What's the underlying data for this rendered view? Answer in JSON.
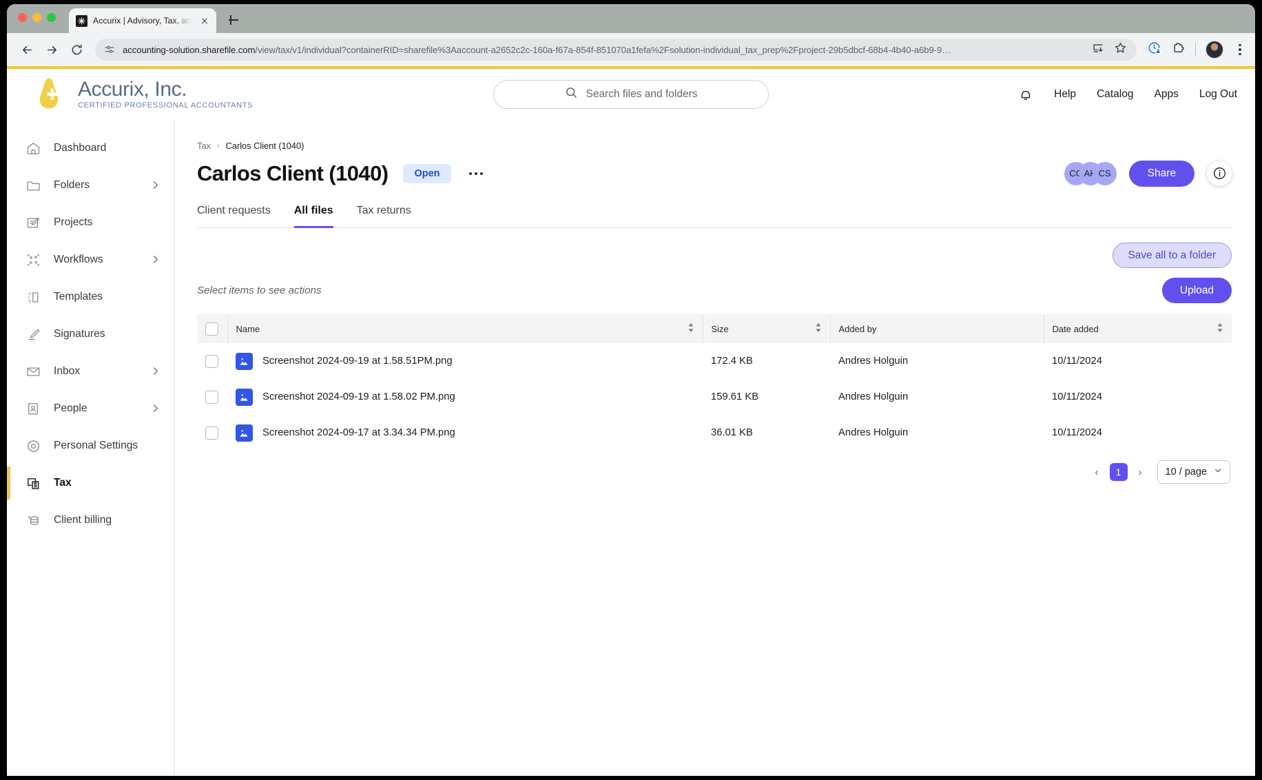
{
  "browser": {
    "tab_title": "Accurix | Advisory, Tax, and A",
    "url_domain": "accounting-solution.sharefile.com",
    "url_path": "/view/tax/v1/individual?containerRID=sharefile%3Aaccount-a2652c2c-160a-f67a-854f-851070a1fefa%2Fsolution-individual_tax_prep%2Fproject-29b5dbcf-68b4-4b40-a6b9-9…",
    "icons": {
      "back": "back-arrow-icon",
      "forward": "forward-arrow-icon",
      "reload": "reload-icon",
      "site_settings": "site-settings-icon",
      "install": "install-app-icon",
      "bookmark": "bookmark-star-icon",
      "extension_shield": "history-sync-icon",
      "extensions": "extensions-puzzle-icon",
      "profile": "profile-avatar-icon",
      "menu": "three-dot-menu-icon"
    }
  },
  "header": {
    "brand_name": "Accurix, Inc.",
    "brand_tagline": "CERTIFIED PROFESSIONAL ACCOUNTANTS",
    "search_placeholder": "Search files and folders",
    "nav": [
      {
        "label": "Help"
      },
      {
        "label": "Catalog"
      },
      {
        "label": "Apps"
      },
      {
        "label": "Log Out"
      }
    ],
    "notification_icon": "bell-icon",
    "accent_bar_color": "#efc94c"
  },
  "sidebar": {
    "items": [
      {
        "label": "Dashboard",
        "icon": "home-icon",
        "chevron": false,
        "active": false
      },
      {
        "label": "Folders",
        "icon": "folder-icon",
        "chevron": true,
        "active": false
      },
      {
        "label": "Projects",
        "icon": "projects-icon",
        "chevron": false,
        "active": false
      },
      {
        "label": "Workflows",
        "icon": "workflows-icon",
        "chevron": true,
        "active": false
      },
      {
        "label": "Templates",
        "icon": "templates-icon",
        "chevron": false,
        "active": false
      },
      {
        "label": "Signatures",
        "icon": "signature-pen-icon",
        "chevron": false,
        "active": false
      },
      {
        "label": "Inbox",
        "icon": "envelope-icon",
        "chevron": true,
        "active": false
      },
      {
        "label": "People",
        "icon": "people-icon",
        "chevron": true,
        "active": false
      },
      {
        "label": "Personal Settings",
        "icon": "gear-icon",
        "chevron": false,
        "active": false
      },
      {
        "label": "Tax",
        "icon": "tax-calculator-icon",
        "chevron": false,
        "active": true
      },
      {
        "label": "Client billing",
        "icon": "billing-stack-icon",
        "chevron": false,
        "active": false
      }
    ]
  },
  "main": {
    "breadcrumb": {
      "root": "Tax",
      "separator": "›",
      "current": "Carlos Client (1040)"
    },
    "page_title": "Carlos Client (1040)",
    "status_badge": "Open",
    "more_actions_icon": "ellipsis-icon",
    "avatars": [
      {
        "initials": "CC"
      },
      {
        "initials": "AH"
      },
      {
        "initials": "CS"
      }
    ],
    "share_label": "Share",
    "info_icon": "info-circle-icon",
    "tabs": [
      {
        "label": "Client requests",
        "active": false
      },
      {
        "label": "All files",
        "active": true
      },
      {
        "label": "Tax returns",
        "active": false
      }
    ],
    "save_all_label": "Save all to a folder",
    "select_hint": "Select items to see actions",
    "upload_label": "Upload",
    "table": {
      "columns": [
        {
          "key": "name",
          "label": "Name",
          "sortable": true
        },
        {
          "key": "size",
          "label": "Size",
          "sortable": true
        },
        {
          "key": "added_by",
          "label": "Added by",
          "sortable": false
        },
        {
          "key": "date_added",
          "label": "Date added",
          "sortable": true
        }
      ],
      "rows": [
        {
          "name": "Screenshot 2024-09-19 at 1.58.51PM.png",
          "size": "172.4 KB",
          "added_by": "Andres Holguin",
          "date_added": "10/11/2024",
          "icon": "image-file-icon"
        },
        {
          "name": "Screenshot 2024-09-19 at 1.58.02 PM.png",
          "size": "159.61 KB",
          "added_by": "Andres Holguin",
          "date_added": "10/11/2024",
          "icon": "image-file-icon"
        },
        {
          "name": "Screenshot 2024-09-17 at 3.34.34 PM.png",
          "size": "36.01 KB",
          "added_by": "Andres Holguin",
          "date_added": "10/11/2024",
          "icon": "image-file-icon"
        }
      ]
    },
    "pagination": {
      "prev": "‹",
      "next": "›",
      "current_page": "1",
      "page_size": "10 / page"
    }
  },
  "colors": {
    "brand_yellow": "#efc94c",
    "primary_purple": "#6250ee",
    "badge_bg": "#dfeaff",
    "badge_text": "#1b4cd1",
    "file_icon_blue": "#3355e8",
    "avatar_purple": "#a7a7f5"
  }
}
